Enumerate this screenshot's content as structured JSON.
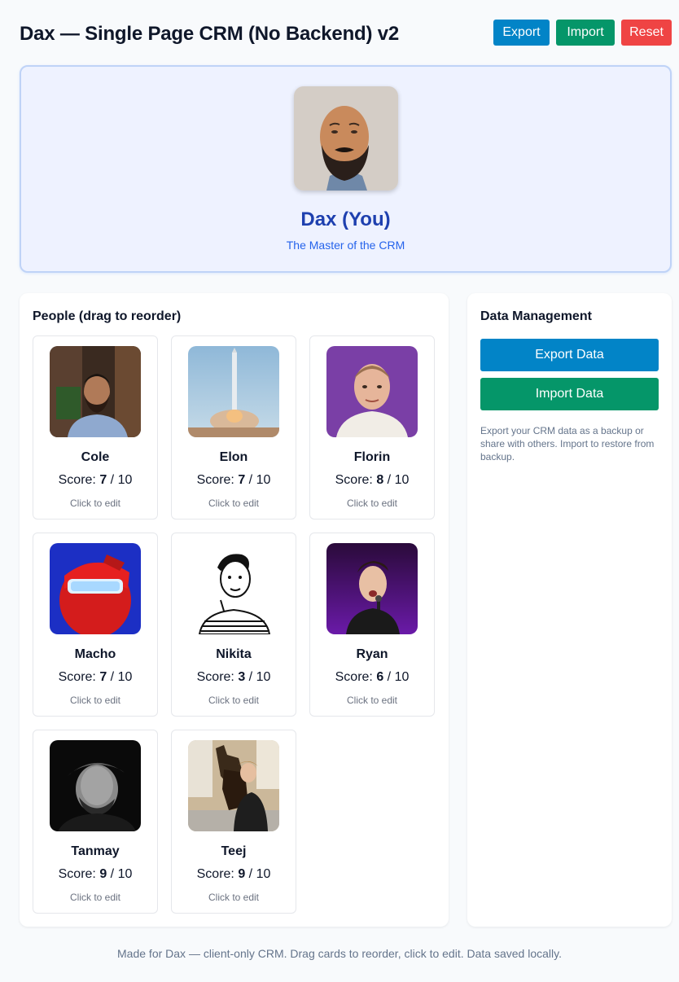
{
  "header": {
    "title": "Dax — Single Page CRM (No Backend) v2",
    "actions": [
      {
        "label": "Export",
        "color": "#0284c7"
      },
      {
        "label": "Import",
        "color": "#059669"
      },
      {
        "label": "Reset",
        "color": "#ef4444"
      }
    ]
  },
  "owner": {
    "name": "Dax (You)",
    "tagline": "The Master of the CRM",
    "avatar": "dax-watercolor-portrait"
  },
  "people_panel": {
    "title": "People (drag to reorder)",
    "score_label": "Score:",
    "score_max": "10",
    "hint": "Click to edit",
    "people": [
      {
        "name": "Cole",
        "score": "7",
        "photo": "cole-photo"
      },
      {
        "name": "Elon",
        "score": "7",
        "photo": "elon-rocket-photo"
      },
      {
        "name": "Florin",
        "score": "8",
        "photo": "florin-photo"
      },
      {
        "name": "Macho",
        "score": "7",
        "photo": "macho-photo"
      },
      {
        "name": "Nikita",
        "score": "3",
        "photo": "nikita-sketch"
      },
      {
        "name": "Ryan",
        "score": "6",
        "photo": "ryan-photo"
      },
      {
        "name": "Tanmay",
        "score": "9",
        "photo": "tanmay-photo"
      },
      {
        "name": "Teej",
        "score": "9",
        "photo": "teej-with-dog-photo"
      }
    ]
  },
  "data_panel": {
    "title": "Data Management",
    "export_label": "Export Data",
    "import_label": "Import Data",
    "description": "Export your CRM data as a backup or share with others. Import to restore from backup.",
    "export_color": "#0284c7",
    "import_color": "#059669"
  },
  "footer": "Made for Dax — client-only CRM. Drag cards to reorder, click to edit. Data saved locally."
}
